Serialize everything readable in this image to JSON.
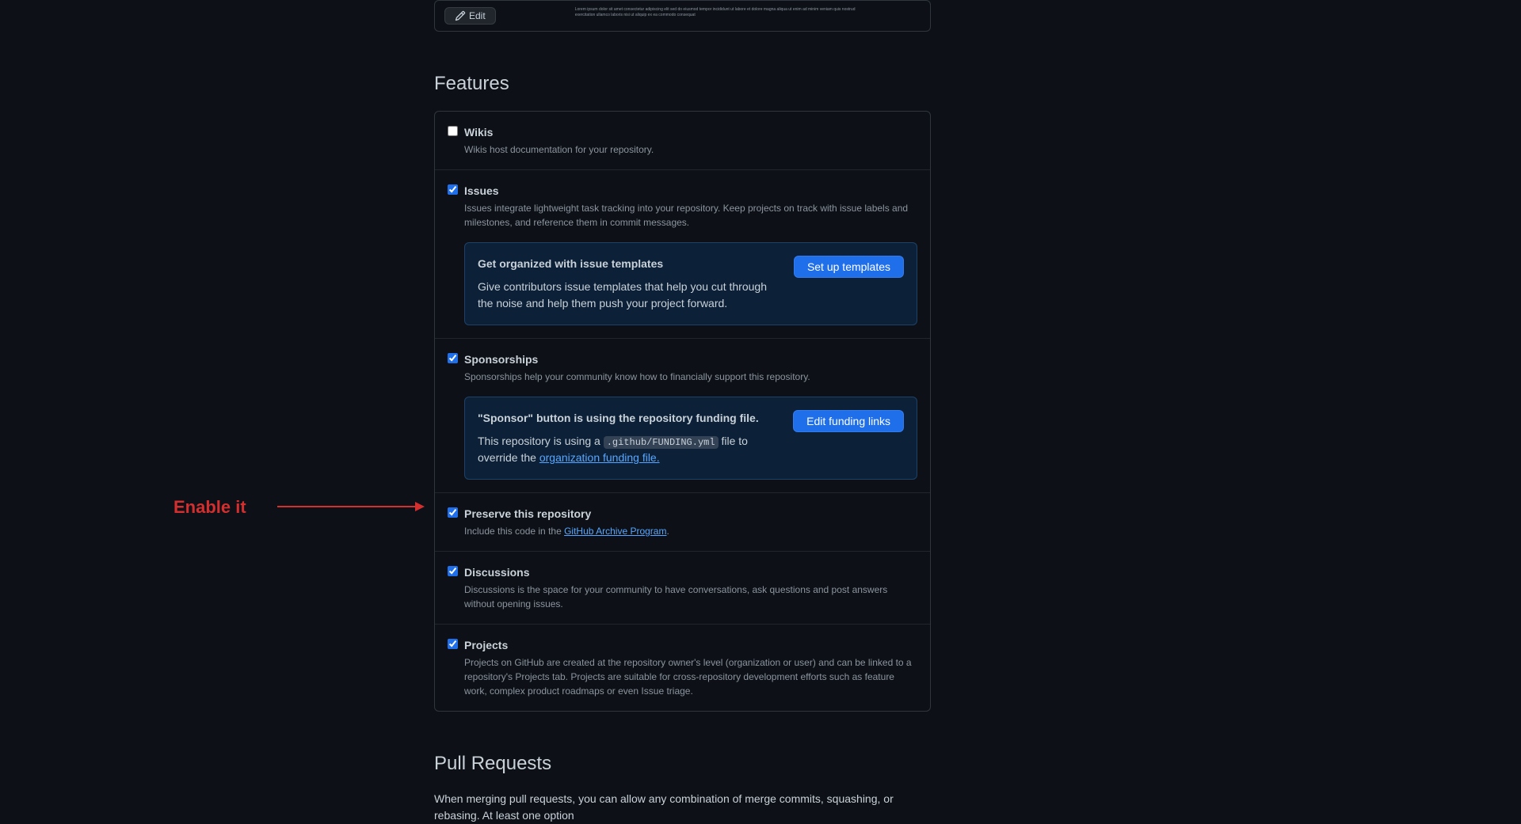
{
  "topCard": {
    "editLabel": "Edit",
    "blurText": "Lorem ipsum dolor sit amet consectetur adipiscing elit sed do eiusmod tempor incididunt ut labore et dolore magna aliqua ut enim ad minim veniam quis nostrud exercitation ullamco laboris nisi ut aliquip ex ea commodo consequat"
  },
  "featuresHeading": "Features",
  "features": {
    "wikis": {
      "title": "Wikis",
      "desc": "Wikis host documentation for your repository.",
      "checked": false
    },
    "issues": {
      "title": "Issues",
      "desc": "Issues integrate lightweight task tracking into your repository. Keep projects on track with issue labels and milestones, and reference them in commit messages.",
      "checked": true,
      "panel": {
        "title": "Get organized with issue templates",
        "desc": "Give contributors issue templates that help you cut through the noise and help them push your project forward.",
        "btn": "Set up templates"
      }
    },
    "sponsorships": {
      "title": "Sponsorships",
      "desc": "Sponsorships help your community know how to financially support this repository.",
      "checked": true,
      "panel": {
        "title": "\"Sponsor\" button is using the repository funding file.",
        "descPrefix": "This repository is using a ",
        "code": ".github/FUNDING.yml",
        "descMiddle": " file to override the ",
        "link": "organization funding file.",
        "btn": "Edit funding links"
      }
    },
    "preserve": {
      "title": "Preserve this repository",
      "descPrefix": "Include this code in the ",
      "link": "GitHub Archive Program",
      "descSuffix": ".",
      "checked": true
    },
    "discussions": {
      "title": "Discussions",
      "desc": "Discussions is the space for your community to have conversations, ask questions and post answers without opening issues.",
      "checked": true
    },
    "projects": {
      "title": "Projects",
      "desc": "Projects on GitHub are created at the repository owner's level (organization or user) and can be linked to a repository's Projects tab. Projects are suitable for cross-repository development efforts such as feature work, complex product roadmaps or even Issue triage.",
      "checked": true
    }
  },
  "pullRequests": {
    "heading": "Pull Requests",
    "desc": "When merging pull requests, you can allow any combination of merge commits, squashing, or rebasing. At least one option"
  },
  "annotation": {
    "text": "Enable it"
  }
}
